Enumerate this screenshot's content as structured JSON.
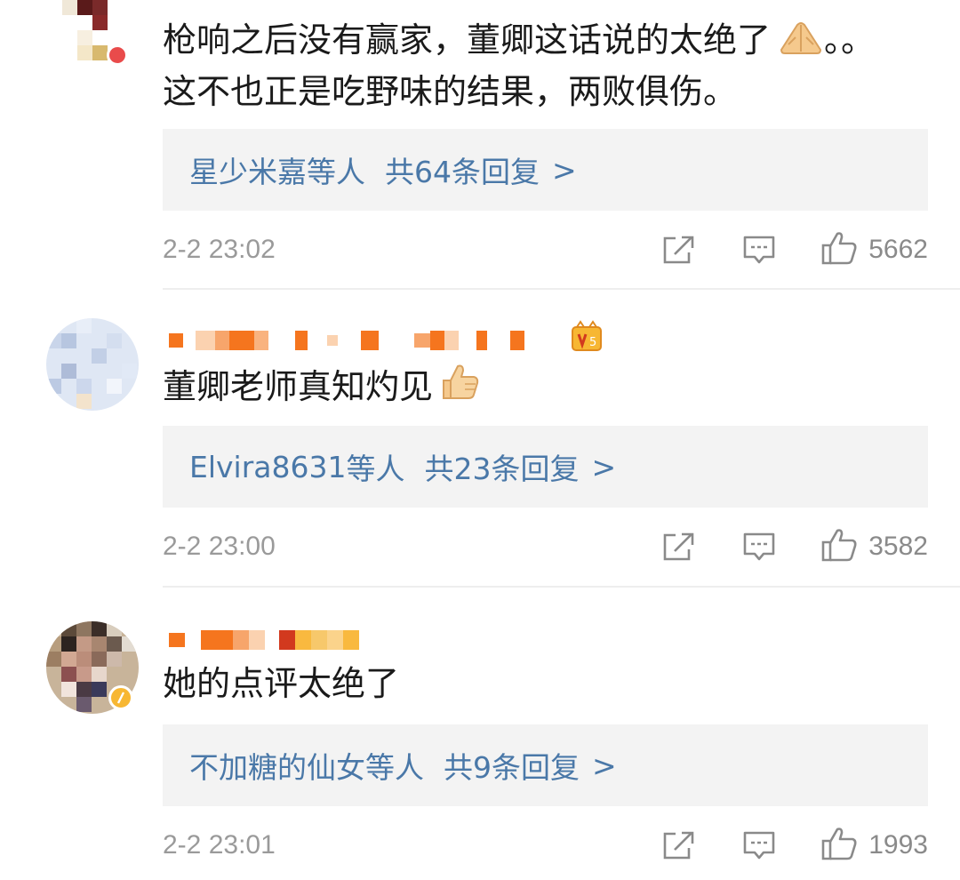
{
  "comments": [
    {
      "text_lines": [
        "枪响之后没有赢家，董卿这话说的太绝了",
        "这不也正是吃野味的结果，两败俱伤。"
      ],
      "text_suffix": "。。",
      "emoji": "folded-hands",
      "reply_names": "星少米嘉",
      "reply_etc": "等人",
      "reply_count": "共64条回复",
      "reply_chevron": ">",
      "time": "2-2 23:02",
      "likes": "5662"
    },
    {
      "text_lines": [
        "董卿老师真知灼见"
      ],
      "emoji": "thumbs-up",
      "reply_names": "Elvira8631",
      "reply_etc": "等人",
      "reply_count": "共23条回复",
      "reply_chevron": ">",
      "time": "2-2 23:00",
      "likes": "3582"
    },
    {
      "text_lines": [
        "她的点评太绝了"
      ],
      "reply_names": "不加糖的仙女",
      "reply_etc": "等人",
      "reply_count": "共9条回复",
      "reply_chevron": ">",
      "time": "2-2 23:01",
      "likes": "1993"
    }
  ],
  "icons": {
    "share": "share-icon",
    "comment": "comment-icon",
    "like": "thumbs-up-icon",
    "vip": "vip-badge-icon"
  },
  "colors": {
    "username_orange": "#f5751e",
    "reply_blue": "#4a78a8",
    "meta_gray": "#9a9a9a",
    "reply_bg": "#f3f3f3"
  }
}
